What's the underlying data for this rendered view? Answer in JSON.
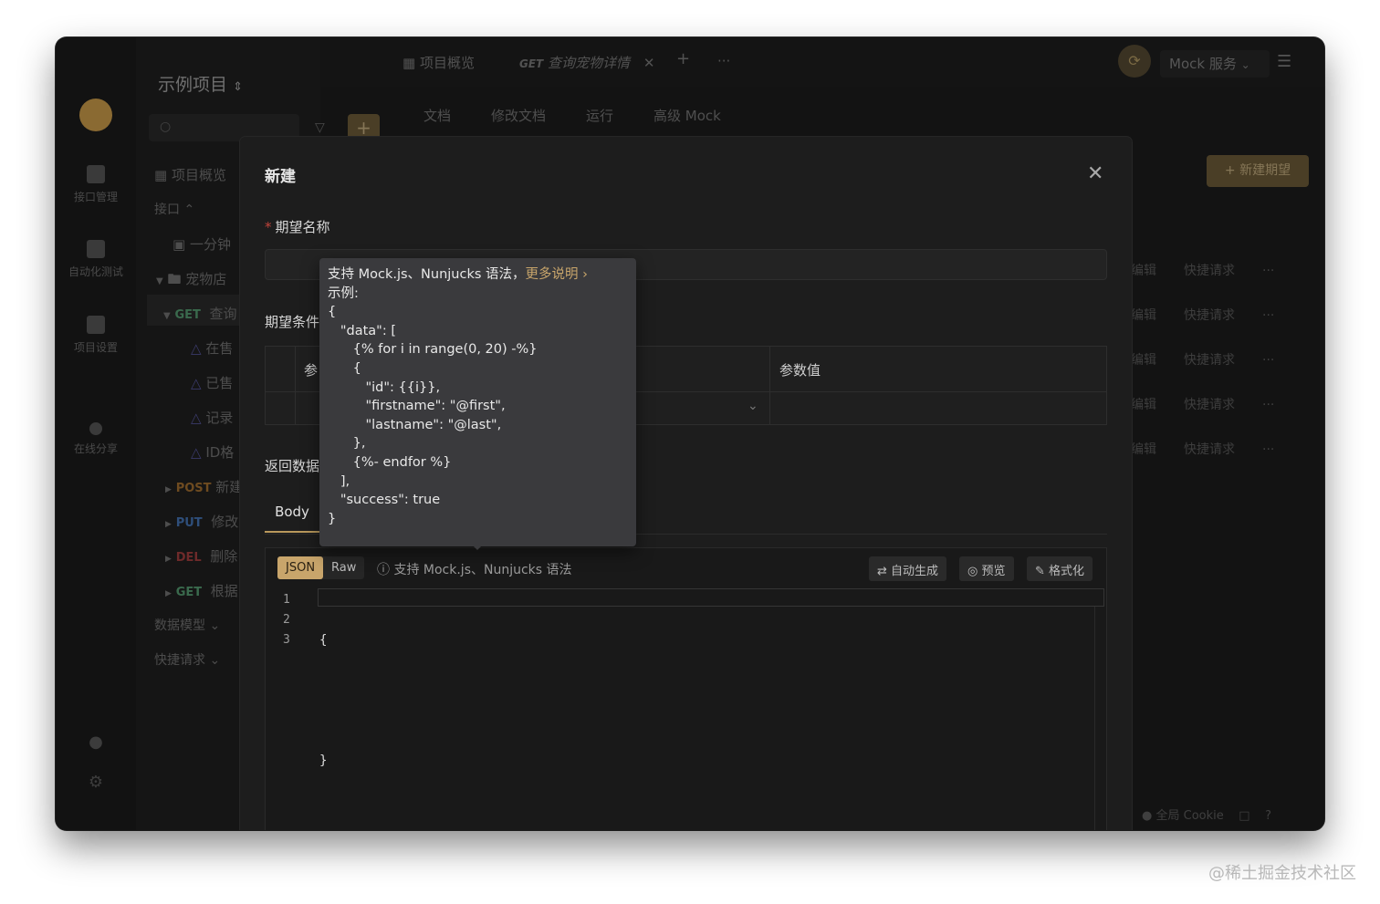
{
  "app": {
    "project_name": "示例项目",
    "tabs": [
      {
        "label": "项目概览"
      },
      {
        "method": "GET",
        "label": "查询宠物详情"
      }
    ],
    "mock_selector": "Mock 服务",
    "sub_tabs": [
      "文档",
      "修改文档",
      "运行",
      "高级 Mock"
    ]
  },
  "rail": {
    "items": [
      "接口管理",
      "自动化测试",
      "项目设置",
      "在线分享"
    ]
  },
  "tree": {
    "overview": "项目概览",
    "api_group": "接口",
    "items": [
      {
        "label": "一分钟"
      },
      {
        "label": "宠物店"
      },
      {
        "method": "GET",
        "label": "查询"
      },
      {
        "label": "在售"
      },
      {
        "label": "已售"
      },
      {
        "label": "记录"
      },
      {
        "label": "ID格"
      },
      {
        "method": "POST",
        "label": "新建"
      },
      {
        "method": "PUT",
        "label": "修改"
      },
      {
        "method": "DEL",
        "label": "删除"
      },
      {
        "method": "GET",
        "label": "根据"
      }
    ],
    "data_models": "数据模型",
    "quick_requests": "快捷请求"
  },
  "background": {
    "new_expectation_button": "+ 新建期望",
    "row_actions": [
      "编辑",
      "快捷请求",
      "···"
    ],
    "footer": {
      "cookie": "全局 Cookie"
    }
  },
  "modal": {
    "title": "新建",
    "expectation_name_label": "期望名称",
    "expectation_name_value": "",
    "conditions_label": "期望条件",
    "cond_col_param": "参",
    "cond_col_value": "参数值",
    "return_label": "返回数据",
    "body_tab": "Body",
    "toolbar": {
      "json": "JSON",
      "raw": "Raw",
      "hint": "支持 Mock.js、Nunjucks 语法",
      "auto_generate": "自动生成",
      "preview": "预览",
      "format": "格式化"
    },
    "editor": {
      "line_numbers": [
        "1",
        "2",
        "3"
      ],
      "lines": [
        "{",
        "",
        "}"
      ]
    }
  },
  "tooltip": {
    "intro": "支持 Mock.js、Nunjucks 语法，",
    "link": "更多说明 ›",
    "example_label": "示例:",
    "code": "{\n   \"data\": [\n      {% for i in range(0, 20) -%}\n      {\n         \"id\": {{i}},\n         \"firstname\": \"@first\",\n         \"lastname\": \"@last\",\n      },\n      {%- endfor %}\n   ],\n   \"success\": true\n}"
  },
  "watermark": "@稀土掘金技术社区"
}
